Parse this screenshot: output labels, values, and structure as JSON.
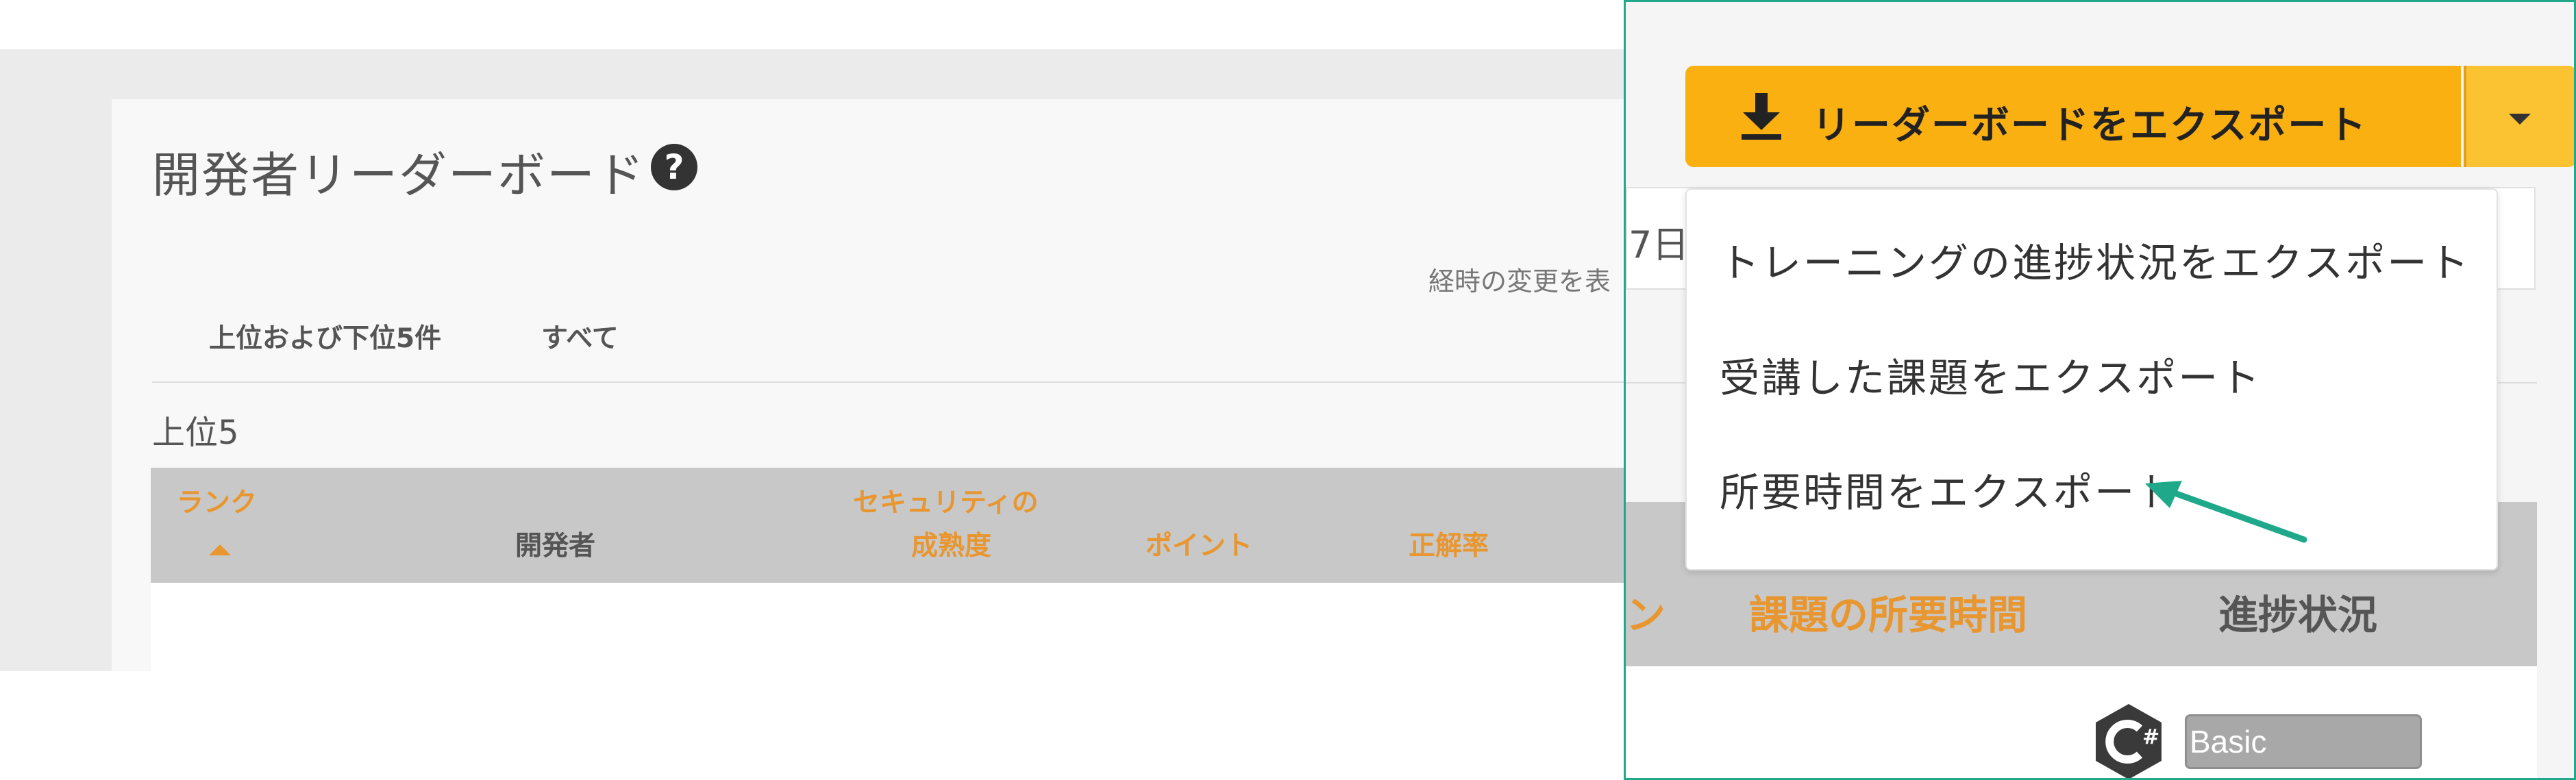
{
  "page": {
    "title": "開発者リーダーボード",
    "hint_text": "経時の変更を表",
    "tabs": [
      "上位および下位5件",
      "すべて"
    ],
    "section_label": "上位5",
    "table_headers": {
      "rank": "ランク",
      "developer": "開発者",
      "security_maturity_line1": "セキュリティの",
      "security_maturity_line2": "成熟度",
      "points": "ポイント",
      "accuracy": "正解率"
    }
  },
  "zoom": {
    "date_fragment": "7日",
    "export_button_label": "リーダーボードをエクスポート",
    "dropdown_items": [
      "トレーニングの進捗状況をエクスポート",
      "受講した課題をエクスポート",
      "所要時間をエクスポート"
    ],
    "table_headers": {
      "partial": "ン",
      "challenge_time": "課題の所要時間",
      "progress": "進捗状況"
    },
    "language_icon": "csharp-icon",
    "badge_label": "Basic",
    "accent_colors": {
      "orange": "#fbb011",
      "teal": "#1fa98a",
      "header_orange": "#e8962f"
    }
  }
}
